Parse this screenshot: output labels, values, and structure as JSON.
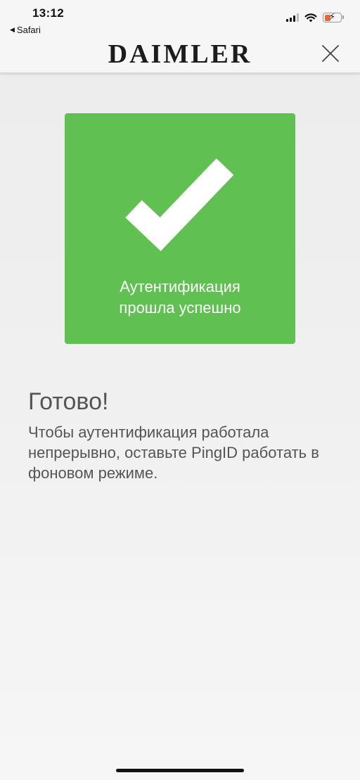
{
  "status_bar": {
    "time": "13:12",
    "back_app": "Safari"
  },
  "header": {
    "brand": "DAIMLER",
    "close_icon": "close-icon"
  },
  "success_card": {
    "text": "Аутентификация прошла успешно",
    "color": "#61c052",
    "icon": "checkmark-icon"
  },
  "message": {
    "title": "Готово!",
    "body": "Чтобы аутентификация работала непрерывно, оставьте PingID работать в фоновом режиме."
  }
}
